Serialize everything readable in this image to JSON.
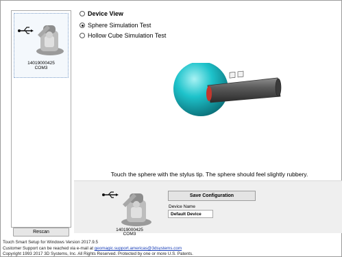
{
  "device_list": {
    "items": [
      {
        "serial": "14019000425",
        "port": "COM3"
      }
    ],
    "rescan_label": "Rescan"
  },
  "test_options": [
    {
      "label": "Device View",
      "checked": false,
      "bold": true
    },
    {
      "label": "Sphere Simulation Test",
      "checked": true,
      "bold": false
    },
    {
      "label": "Hollow Cube Simulation Test",
      "checked": false,
      "bold": false
    }
  ],
  "instruction": "Touch the sphere with the stylus tip. The sphere should feel slightly rubbery.",
  "config": {
    "save_label": "Save Configuration",
    "device_name_label": "Device Name",
    "device_name_value": "Default Device",
    "serial": "14019000425",
    "port": "COM3"
  },
  "footer": {
    "version": "Touch Smart Setup for Windows Version 2017.9.5",
    "support_prefix": "Customer Support can be reached via e-mail at",
    "support_email": "geomagic.support.americas@3dsystems.com",
    "copyright": "Copyright 1993 2017 3D Systems, Inc. All Rights Reserved. Protected by one or more U.S. Patents."
  },
  "colors": {
    "sphere": "#1ec3cb",
    "stylus": "#5a5a5a",
    "stylus_tip": "#c2372e",
    "link": "#1a3fb8"
  },
  "icons": {
    "usb": "usb-icon",
    "device": "haptic-device-icon"
  }
}
